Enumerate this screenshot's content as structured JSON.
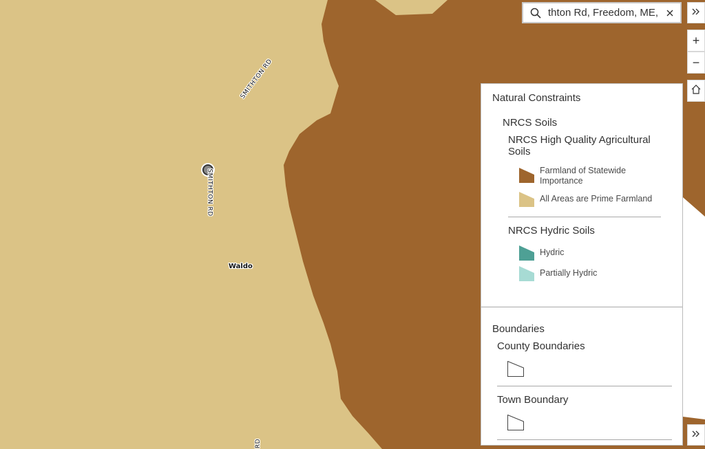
{
  "map": {
    "colors": {
      "prime_farmland": "#dbc386",
      "statewide_importance": "#9e652d"
    },
    "labels": {
      "road_upper": "SMITHTON RD",
      "road_vertical": "SMITHTON RD",
      "place": "Waldo",
      "road_bottom": "RD"
    }
  },
  "search": {
    "value": "thton Rd, Freedom, ME, (",
    "search_icon": "search-icon",
    "clear_icon": "close-icon"
  },
  "controls": {
    "expand_icon": "chevrons-right-icon",
    "zoom_in_label": "+",
    "zoom_out_label": "−",
    "home_icon": "home-icon"
  },
  "legend": {
    "title": "Natural Constraints",
    "group": "NRCS Soils",
    "agri_title": "NRCS High Quality Agricultural Soils",
    "agri_items": [
      {
        "label": "Farmland of Statewide Importance",
        "color": "#9e652d"
      },
      {
        "label": "All Areas are Prime Farmland",
        "color": "#dbc386"
      }
    ],
    "hydric_title": "NRCS Hydric Soils",
    "hydric_items": [
      {
        "label": "Hydric",
        "color": "#4ea095"
      },
      {
        "label": "Partially Hydric",
        "color": "#a7dbd4"
      }
    ],
    "boundaries_title": "Boundaries",
    "county_title": "County Boundaries",
    "town_title": "Town Boundary"
  }
}
